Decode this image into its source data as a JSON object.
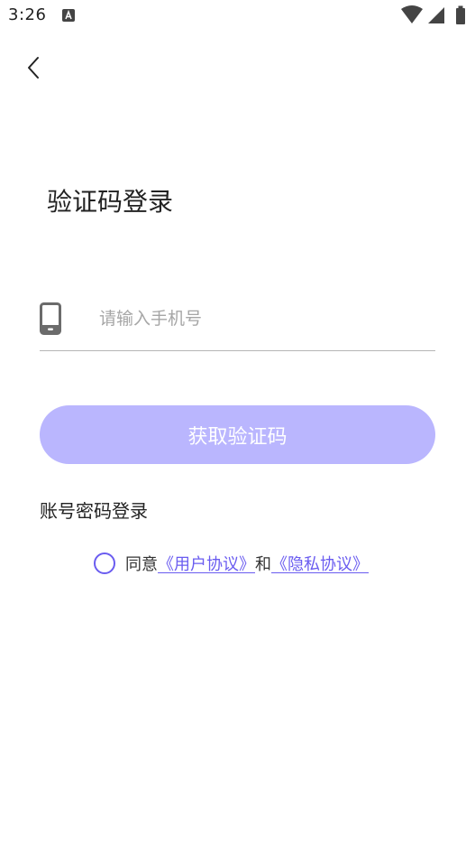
{
  "status_bar": {
    "time": "3:26",
    "icons": [
      "notification-icon",
      "wifi-icon",
      "signal-icon",
      "battery-icon"
    ]
  },
  "header": {
    "back_icon": "chevron-left-icon"
  },
  "title": "验证码登录",
  "phone": {
    "icon": "phone-icon",
    "value": "",
    "placeholder": "请输入手机号"
  },
  "get_code_button": {
    "label": "获取验证码"
  },
  "account_login": {
    "label": "账号密码登录"
  },
  "agreement": {
    "prefix": "同意",
    "user_agreement": "《用户协议》",
    "conjunction": "和",
    "privacy_policy": "《隐私协议》"
  },
  "colors": {
    "accent": "#6a5cf0",
    "button_disabled": "#bab6fe",
    "background": "#ffffff"
  }
}
